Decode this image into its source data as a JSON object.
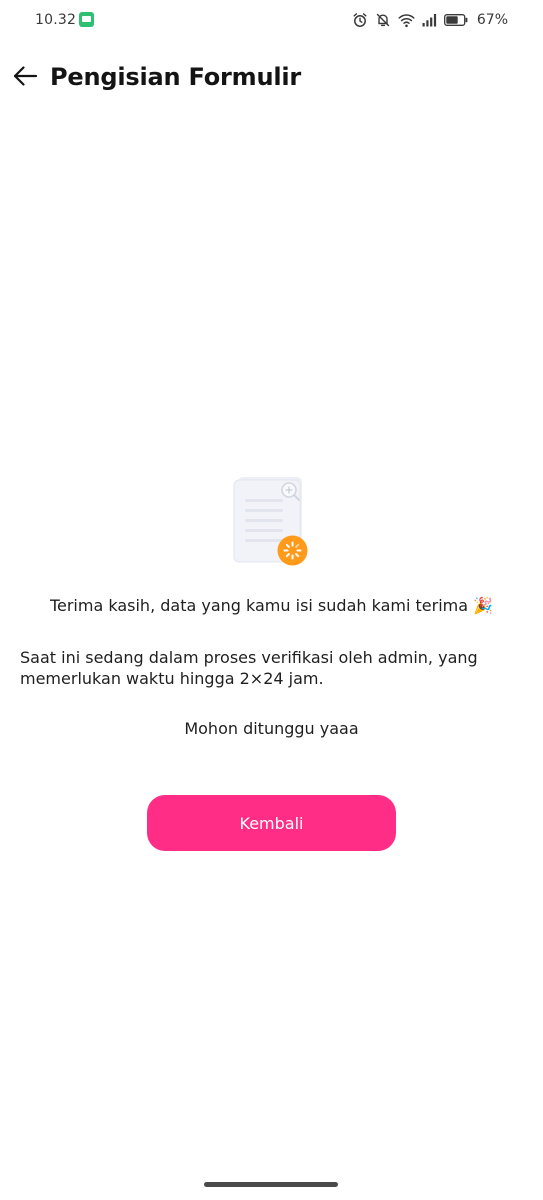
{
  "status_bar": {
    "time": "10.32",
    "battery_percent": "67%"
  },
  "header": {
    "title": "Pengisian Formulir"
  },
  "content": {
    "thanks_text": "Terima kasih, data yang kamu isi sudah kami terima 🎉",
    "verification_text": "Saat ini sedang dalam proses verifikasi oleh admin, yang memerlukan waktu hingga 2×24 jam.",
    "wait_text": "Mohon ditunggu yaaa"
  },
  "actions": {
    "back_button_label": "Kembali"
  },
  "colors": {
    "primary": "#ff2d86",
    "badge": "#ff9a1a",
    "status_icon": "#3a3a3a"
  },
  "icons": {
    "notification_app": "chat-app-icon",
    "alarm": "alarm-icon",
    "dnd": "bell-off-icon",
    "wifi": "wifi-icon",
    "signal": "cellular-signal-icon",
    "battery": "battery-icon",
    "back": "arrow-left-icon",
    "illustration": "document-review-illustration",
    "loading_badge": "loading-spinner-icon"
  }
}
